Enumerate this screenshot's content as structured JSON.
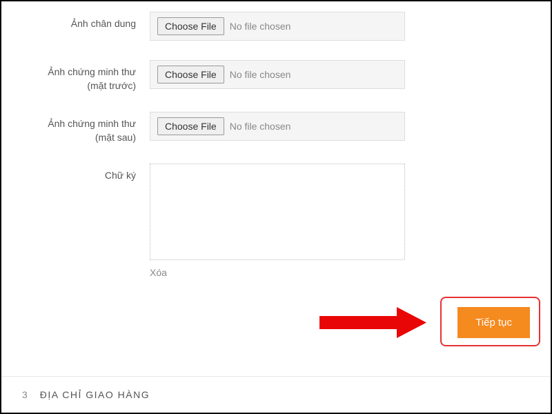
{
  "form": {
    "portrait": {
      "label": "Ảnh chân dung",
      "choose_btn": "Choose File",
      "status": "No file chosen"
    },
    "id_front": {
      "label_line1": "Ảnh chứng minh thư",
      "label_line2": "(mặt trước)",
      "choose_btn": "Choose File",
      "status": "No file chosen"
    },
    "id_back": {
      "label_line1": "Ảnh chứng minh thư",
      "label_line2": "(mặt sau)",
      "choose_btn": "Choose File",
      "status": "No file chosen"
    },
    "signature": {
      "label": "Chữ ký",
      "clear": "Xóa"
    }
  },
  "actions": {
    "continue": "Tiếp tục"
  },
  "footer": {
    "number": "3",
    "title": "ĐỊA CHỈ GIAO HÀNG"
  }
}
